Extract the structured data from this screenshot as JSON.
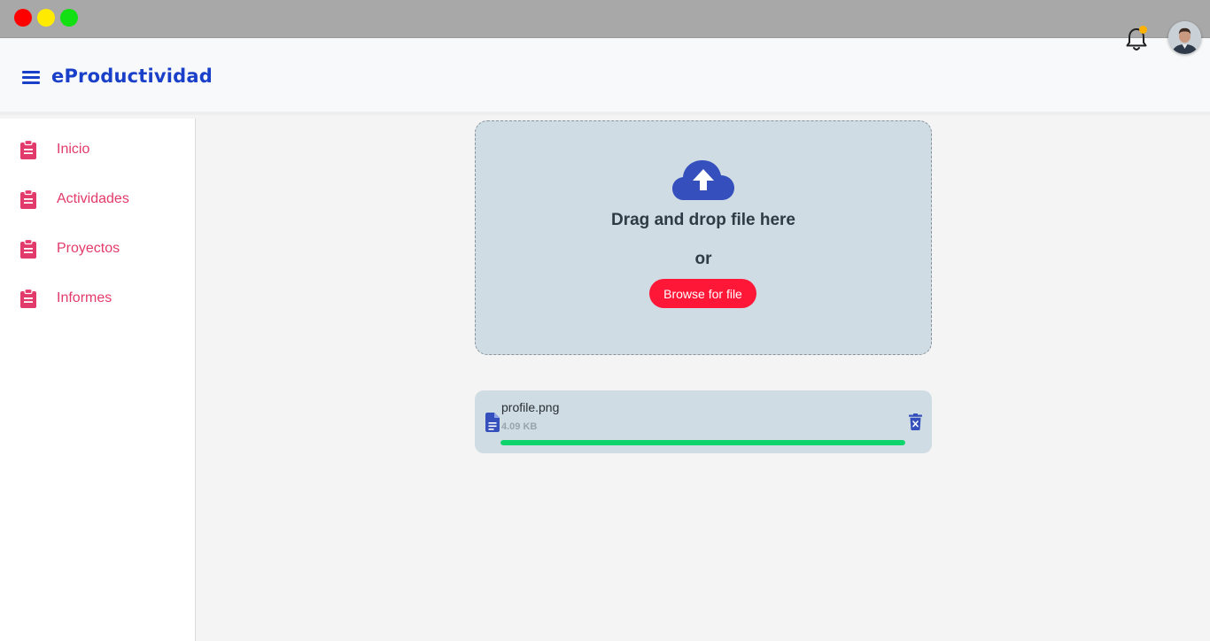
{
  "header": {
    "brand": "eProductividad"
  },
  "sidebar": {
    "items": [
      {
        "label": "Inicio",
        "icon": "clipboard-icon"
      },
      {
        "label": "Actividades",
        "icon": "clipboard-icon"
      },
      {
        "label": "Proyectos",
        "icon": "clipboard-icon"
      },
      {
        "label": "Informes",
        "icon": "clipboard-icon"
      }
    ]
  },
  "upload": {
    "title": "Drag and drop file here",
    "or_text": "or",
    "browse_label": "Browse for file",
    "icon": "cloud-upload-icon"
  },
  "file": {
    "name": "profile.png",
    "size": "4.09 KB",
    "progress_percent": 100,
    "icon": "document-icon"
  },
  "colors": {
    "brand": "#1a3fc8",
    "nav_text": "#e23a6a",
    "browse_button": "#ff1738",
    "progress": "#0dd46b",
    "notification_dot": "#ffb300"
  }
}
